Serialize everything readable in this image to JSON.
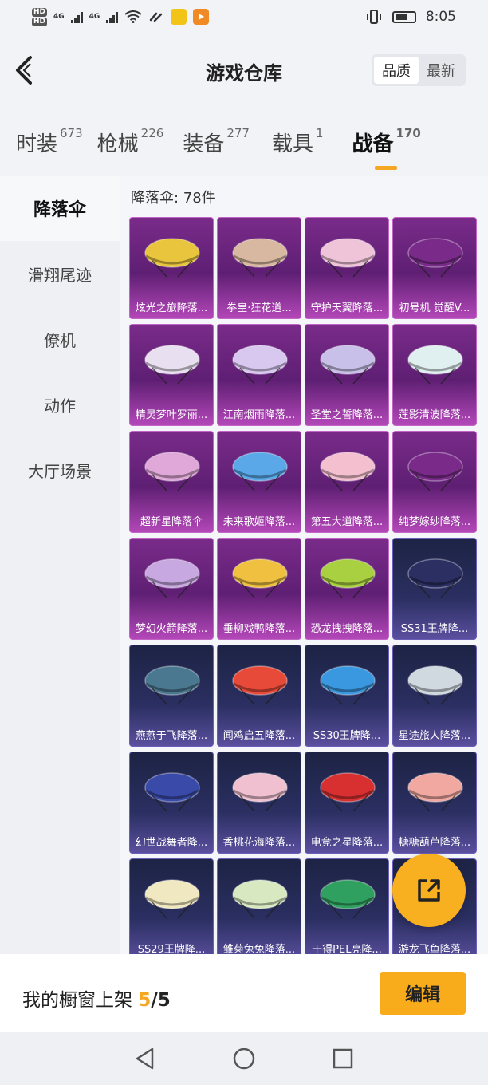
{
  "status_bar": {
    "time": "8:05",
    "hd1": "HD",
    "hd2": "HD",
    "net1": "4G",
    "net2": "4G"
  },
  "header": {
    "title": "游戏仓库",
    "sort_quality": "品质",
    "sort_newest": "最新"
  },
  "tabs": [
    {
      "label": "时装",
      "count": "673"
    },
    {
      "label": "枪械",
      "count": "226"
    },
    {
      "label": "装备",
      "count": "277"
    },
    {
      "label": "载具",
      "count": "1"
    },
    {
      "label": "战备",
      "count": "170"
    }
  ],
  "sidebar": {
    "items": [
      {
        "label": "降落伞"
      },
      {
        "label": "滑翔尾迹"
      },
      {
        "label": "僚机"
      },
      {
        "label": "动作"
      },
      {
        "label": "大厅场景"
      }
    ]
  },
  "main": {
    "count_label": "降落伞: 78件",
    "items": [
      {
        "name": "炫光之旅降落...",
        "tier": "purple",
        "color": "#e8c53c",
        "icon": "parachute-icon"
      },
      {
        "name": "拳皇·狂花道...",
        "tier": "purple",
        "color": "#d8b8a0",
        "icon": "parachute-icon"
      },
      {
        "name": "守护天翼降落...",
        "tier": "purple",
        "color": "#f0c4d8",
        "icon": "parachute-icon"
      },
      {
        "name": "初号机 觉醒V...",
        "tier": "purple",
        "color": "#7a2b8a",
        "icon": "parachute-icon"
      },
      {
        "name": "精灵梦叶罗丽...",
        "tier": "purple",
        "color": "#e8e0f0",
        "icon": "parachute-icon"
      },
      {
        "name": "江南烟雨降落...",
        "tier": "purple",
        "color": "#d8c8f0",
        "icon": "parachute-icon"
      },
      {
        "name": "圣堂之誓降落...",
        "tier": "purple",
        "color": "#c8c0e8",
        "icon": "parachute-icon"
      },
      {
        "name": "莲影清波降落...",
        "tier": "purple",
        "color": "#e0f0f0",
        "icon": "parachute-icon"
      },
      {
        "name": "超新星降落伞",
        "tier": "purple",
        "color": "#e0a8d8",
        "icon": "parachute-icon"
      },
      {
        "name": "未来歌姬降落...",
        "tier": "purple",
        "color": "#5aa8e8",
        "icon": "parachute-icon"
      },
      {
        "name": "第五大道降落...",
        "tier": "purple",
        "color": "#f4c0d0",
        "icon": "parachute-icon"
      },
      {
        "name": "纯梦嫁纱降落...",
        "tier": "purple",
        "color": "#7a2b8a",
        "icon": "parachute-icon"
      },
      {
        "name": "梦幻火箭降落...",
        "tier": "purple",
        "color": "#c8a8e0",
        "icon": "parachute-icon"
      },
      {
        "name": "垂柳戏鸭降落...",
        "tier": "purple",
        "color": "#f0c040",
        "icon": "parachute-icon"
      },
      {
        "name": "恐龙拽拽降落...",
        "tier": "purple",
        "color": "#a8d040",
        "icon": "parachute-icon"
      },
      {
        "name": "SS31王牌降...",
        "tier": "blue",
        "color": "#2b2f62",
        "icon": "parachute-icon"
      },
      {
        "name": "燕燕于飞降落...",
        "tier": "blue",
        "color": "#4a7890",
        "icon": "parachute-icon"
      },
      {
        "name": "闻鸡启五降落...",
        "tier": "blue",
        "color": "#e84a3a",
        "icon": "parachute-icon"
      },
      {
        "name": "SS30王牌降...",
        "tier": "blue",
        "color": "#3a98e0",
        "icon": "parachute-icon"
      },
      {
        "name": "星途旅人降落...",
        "tier": "blue",
        "color": "#d0d8e0",
        "icon": "parachute-icon"
      },
      {
        "name": "幻世战舞者降...",
        "tier": "blue",
        "color": "#3a4aa8",
        "icon": "parachute-icon"
      },
      {
        "name": "香桃花海降落...",
        "tier": "blue",
        "color": "#f0c0d0",
        "icon": "parachute-icon"
      },
      {
        "name": "电竞之星降落...",
        "tier": "blue",
        "color": "#d83030",
        "icon": "parachute-icon"
      },
      {
        "name": "糖糖葫芦降落...",
        "tier": "blue",
        "color": "#f0a8a0",
        "icon": "parachute-icon"
      },
      {
        "name": "SS29王牌降...",
        "tier": "blue",
        "color": "#f0e8c0",
        "icon": "parachute-icon"
      },
      {
        "name": "雏菊兔兔降落...",
        "tier": "blue",
        "color": "#d8e8c0",
        "icon": "parachute-icon"
      },
      {
        "name": "干得PEL亮降...",
        "tier": "blue",
        "color": "#30a060",
        "icon": "parachute-icon"
      },
      {
        "name": "游龙飞鱼降落...",
        "tier": "blue",
        "color": "#2b2f62",
        "icon": "parachute-icon"
      }
    ]
  },
  "bottom": {
    "showcase_label": "我的橱窗上架",
    "showcase_count": "5",
    "showcase_total": "/5",
    "edit_label": "编辑"
  },
  "colors": {
    "accent": "#f5a623",
    "purple_tier": "#7a2b8a",
    "blue_tier": "#2b2f62"
  }
}
